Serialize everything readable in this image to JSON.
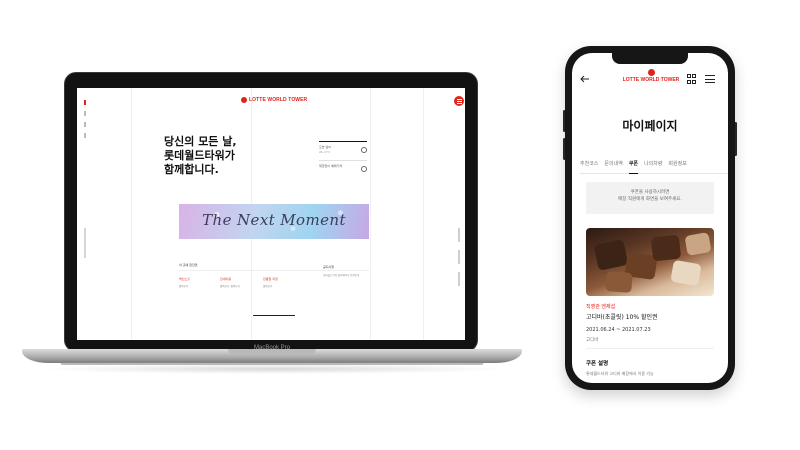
{
  "laptop": {
    "brand_label": "MacBook Pro",
    "site": {
      "logo_text": "LOTTE WORLD TOWER",
      "headline": "당신의 모든 날,\n롯데월드타워가\n함께합니다.",
      "info_items": [
        {
          "label": "오늘 날씨",
          "sub": "26~27℃"
        },
        {
          "label": "제한없이 예매가격",
          "sub": ""
        }
      ],
      "banner_text": "The Next Moment",
      "section_title": "이 곳에 잠깐만",
      "columns": [
        {
          "title": "백신노출",
          "sub": "알아보기"
        },
        {
          "title": "관내이용",
          "sub": "알아보기, 알아보기"
        },
        {
          "title": "관람일 지정",
          "sub": "알아보기"
        }
      ],
      "notice_title": "공지사항",
      "notice_text": "롯데월드타워 엘리베이터 운영안내"
    }
  },
  "phone": {
    "logo_text": "LOTTE WORLD TOWER",
    "page_title": "마이페이지",
    "tabs": [
      "추천코스",
      "문의내역",
      "쿠폰",
      "나의차량",
      "회원정보"
    ],
    "active_tab": "쿠폰",
    "notice_lines": [
      "쿠폰을 사용하시려면",
      "매장 직원에게 화면을 보여주세요."
    ],
    "coupon": {
      "category": "직영관 엔제섭",
      "name": "고디바(초콜릿) 10% 할인권",
      "period": "2021.06.24 ~ 2021.07.23",
      "place": "고디바"
    },
    "description_title": "쿠폰 설명",
    "description_text": "롯데월드타워 고디바 매장에서 이용 가능"
  }
}
